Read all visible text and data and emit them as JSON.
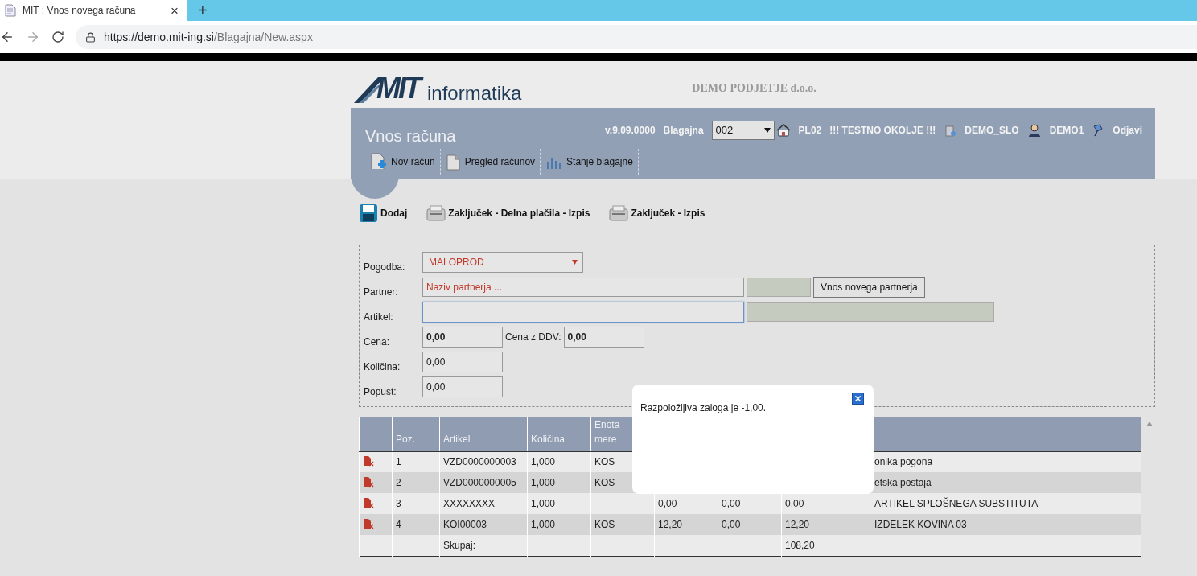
{
  "browser": {
    "tab_title": "MIT : Vnos novega računa",
    "tab_close": "×",
    "new_tab": "+",
    "url_host": "https://demo.mit-ing.si",
    "url_path": "/Blagajna/New.aspx"
  },
  "header": {
    "logo_mark": "MIT",
    "logo_name": "informatika",
    "company": "DEMO PODJETJE d.o.o.",
    "title": "Vnos računa",
    "version": "v.9.09.0000",
    "register_label": "Blagajna",
    "register_value": "002",
    "links": [
      {
        "kind": "home",
        "label": "PL02"
      },
      {
        "kind": "plain",
        "label": "!!! TESTNO OKOLJE !!!"
      },
      {
        "kind": "company",
        "label": "DEMO_SLO"
      },
      {
        "kind": "user",
        "label": "DEMO1"
      },
      {
        "kind": "logout",
        "label": "Odjavi"
      }
    ],
    "menu": [
      {
        "kind": "new",
        "label": "Nov račun"
      },
      {
        "kind": "list",
        "label": "Pregled računov"
      },
      {
        "kind": "chart",
        "label": "Stanje blagajne"
      }
    ]
  },
  "actions": [
    {
      "kind": "save",
      "label": "Dodaj"
    },
    {
      "kind": "print",
      "label": "Zaključek - Delna plačila - Izpis"
    },
    {
      "kind": "print",
      "label": "Zaključek - Izpis"
    }
  ],
  "form": {
    "contract": {
      "label": "Pogodba:",
      "value": "MALOPROD"
    },
    "partner": {
      "label": "Partner:",
      "placeholder": "Naziv partnerja ...",
      "button": "Vnos novega partnerja"
    },
    "article": {
      "label": "Artikel:",
      "focused": true
    },
    "price": {
      "label": "Cena:",
      "value": "0,00"
    },
    "price_vat": {
      "label": "Cena z DDV:",
      "value": "0,00"
    },
    "quantity": {
      "label": "Količina:",
      "value": "0,00"
    },
    "discount": {
      "label": "Popust:",
      "value": "0,00"
    }
  },
  "table": {
    "columns": [
      "Poz.",
      "Artikel",
      "Količina",
      "Enota mere"
    ],
    "rows": [
      {
        "poz": "1",
        "artikel": "VZD0000000003",
        "kolicina": "1,000",
        "enota": "KOS",
        "column_8": "onika pogona"
      },
      {
        "poz": "2",
        "artikel": "VZD0000000005",
        "kolicina": "1,000",
        "enota": "KOS",
        "column_8": "etska postaja"
      },
      {
        "poz": "3",
        "artikel": "XXXXXXXX",
        "kolicina": "1,000",
        "column_5": "0,00",
        "column_6": "0,00",
        "column_7": "0,00",
        "column_8": "ARTIKEL SPLOŠNEGA SUBSTITUTA"
      },
      {
        "poz": "4",
        "artikel": "KOI00003",
        "kolicina": "1,000",
        "enota": "KOS",
        "column_5": "12,20",
        "column_6": "0,00",
        "column_7": "12,20",
        "column_8": "IZDELEK KOVINA 03"
      }
    ],
    "total": {
      "label": "Skupaj:",
      "column_7": "108,20"
    }
  },
  "dialog": {
    "message": "Razpoložljiva zaloga je -1,00."
  }
}
